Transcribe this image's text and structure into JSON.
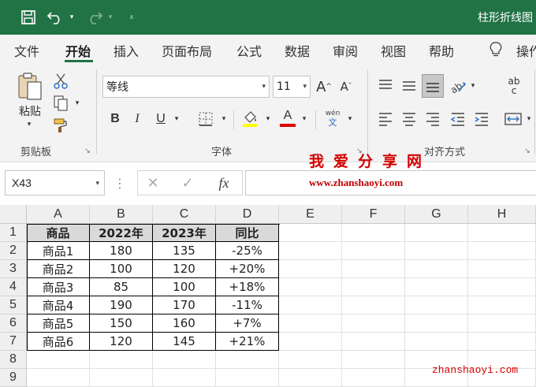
{
  "window": {
    "title": "柱形折线图"
  },
  "menu": {
    "tabs": [
      "文件",
      "开始",
      "插入",
      "页面布局",
      "公式",
      "数据",
      "审阅",
      "视图",
      "帮助"
    ],
    "tell": "操作"
  },
  "ribbon": {
    "clipboard": {
      "paste": "粘贴",
      "label": "剪贴板"
    },
    "font": {
      "name": "等线",
      "size": "11",
      "bold": "B",
      "italic": "I",
      "underline": "U",
      "color_a": "A",
      "phonetic_top": "wén",
      "phonetic_bottom": "文",
      "label": "字体"
    },
    "align": {
      "label": "对齐方式",
      "wrap_top": "ab",
      "wrap_bottom": "c"
    }
  },
  "formula_bar": {
    "name_box": "X43",
    "fx": "fx",
    "value": ""
  },
  "watermark": {
    "title": "我爱分享网",
    "url": "www.zhanshaoyi.com",
    "corner": "zhanshaoyi.com"
  },
  "sheet": {
    "columns": [
      "A",
      "B",
      "C",
      "D",
      "E",
      "F",
      "G",
      "H"
    ],
    "rows": [
      "1",
      "2",
      "3",
      "4",
      "5",
      "6",
      "7",
      "8",
      "9"
    ],
    "headers": [
      "商品",
      "2022年",
      "2023年",
      "同比"
    ],
    "data": [
      [
        "商品1",
        "180",
        "135",
        "-25%"
      ],
      [
        "商品2",
        "100",
        "120",
        "+20%"
      ],
      [
        "商品3",
        "85",
        "100",
        "+18%"
      ],
      [
        "商品4",
        "190",
        "170",
        "-11%"
      ],
      [
        "商品5",
        "150",
        "160",
        "+7%"
      ],
      [
        "商品6",
        "120",
        "145",
        "+21%"
      ]
    ]
  },
  "colors": {
    "accent": "#217346",
    "font_color": "#e00000",
    "highlight": "#ffff00"
  }
}
